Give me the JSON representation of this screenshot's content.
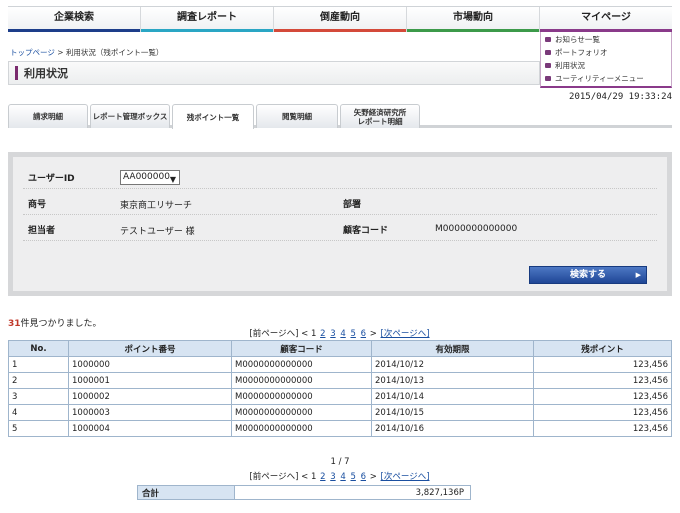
{
  "nav": {
    "items": [
      "企業検索",
      "調査レポート",
      "倒産動向",
      "市場動向",
      "マイページ"
    ]
  },
  "mypage_menu": {
    "items": [
      "お知らせ一覧",
      "ポートフォリオ",
      "利用状況",
      "ユーティリティーメニュー"
    ]
  },
  "breadcrumb": {
    "home": "トップページ",
    "sep": ">",
    "current": "利用状況（残ポイント一覧）"
  },
  "page_title": "利用状況",
  "timestamp": "2015/04/29 19:33:24",
  "tabs": {
    "t1": "請求明細",
    "t2": "レポート管理ボックス",
    "t3": "残ポイント一覧",
    "t4": "閲覧明細",
    "t5a": "矢野経済研究所",
    "t5b": "レポート明細"
  },
  "search": {
    "user_id_label": "ユーザーID",
    "user_id_value": "AA000000",
    "company_label": "商号",
    "company_value": "東京商工リサーチ",
    "dept_label": "部署",
    "dept_value": "",
    "person_label": "担当者",
    "person_value": "テストユーザー 様",
    "customer_code_label": "顧客コード",
    "customer_code_value": "M0000000000000",
    "search_button": "検索する"
  },
  "results": {
    "count": "31",
    "count_suffix": "件見つかりました。"
  },
  "pager": {
    "prev": "[前ページへ]",
    "lt": "<",
    "current": "1",
    "pages": [
      "2",
      "3",
      "4",
      "5",
      "6"
    ],
    "gt": ">",
    "next": "[次ページへ]"
  },
  "table": {
    "headers": [
      "No.",
      "ポイント番号",
      "顧客コード",
      "有効期限",
      "残ポイント"
    ],
    "rows": [
      [
        "1",
        "1000000",
        "M0000000000000",
        "2014/10/12",
        "123,456"
      ],
      [
        "2",
        "1000001",
        "M0000000000000",
        "2014/10/13",
        "123,456"
      ],
      [
        "3",
        "1000002",
        "M0000000000000",
        "2014/10/14",
        "123,456"
      ],
      [
        "4",
        "1000003",
        "M0000000000000",
        "2014/10/15",
        "123,456"
      ],
      [
        "5",
        "1000004",
        "M0000000000000",
        "2014/10/16",
        "123,456"
      ]
    ]
  },
  "page_indicator": "1 / 7",
  "total": {
    "label": "合計",
    "value": "3,827,136P"
  }
}
